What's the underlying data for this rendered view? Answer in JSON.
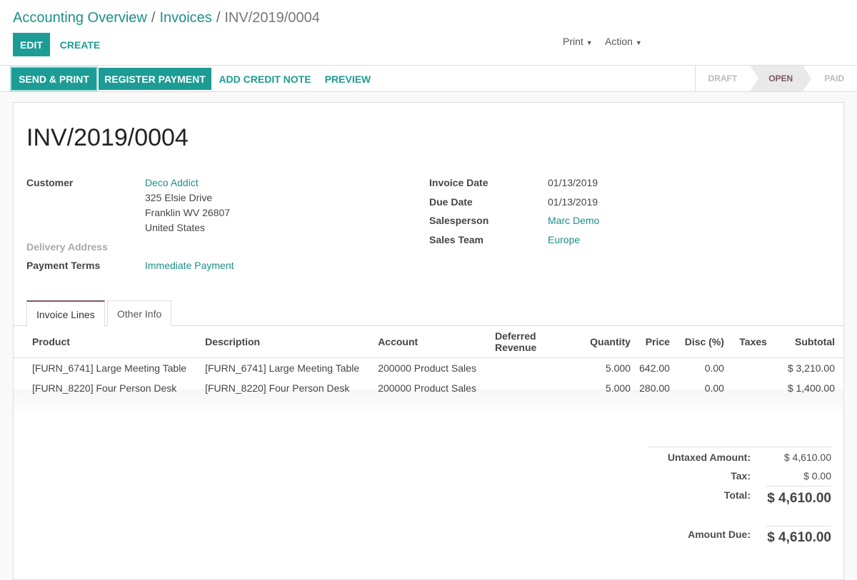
{
  "breadcrumb": {
    "items": [
      "Accounting Overview",
      "Invoices"
    ],
    "current": "INV/2019/0004"
  },
  "buttons": {
    "edit": "EDIT",
    "create": "CREATE",
    "print": "Print",
    "action": "Action",
    "send_print": "SEND & PRINT",
    "register_payment": "REGISTER PAYMENT",
    "add_credit_note": "ADD CREDIT NOTE",
    "preview": "PREVIEW"
  },
  "status": [
    "DRAFT",
    "OPEN",
    "PAID"
  ],
  "invoice": {
    "number": "INV/2019/0004",
    "customer_label": "Customer",
    "customer": "Deco Addict",
    "address": [
      "325 Elsie Drive",
      "Franklin WV 26807",
      "United States"
    ],
    "delivery_label": "Delivery Address",
    "payment_terms_label": "Payment Terms",
    "payment_terms": "Immediate Payment",
    "invoice_date_label": "Invoice Date",
    "invoice_date": "01/13/2019",
    "due_date_label": "Due Date",
    "due_date": "01/13/2019",
    "salesperson_label": "Salesperson",
    "salesperson": "Marc Demo",
    "team_label": "Sales Team",
    "team": "Europe"
  },
  "tabs": [
    "Invoice Lines",
    "Other Info"
  ],
  "columns": [
    "Product",
    "Description",
    "Account",
    "Deferred Revenue",
    "Quantity",
    "Price",
    "Disc (%)",
    "Taxes",
    "Subtotal"
  ],
  "lines": [
    {
      "product": "[FURN_6741] Large Meeting Table",
      "description": "[FURN_6741] Large Meeting Table",
      "account": "200000 Product Sales",
      "deferred": "",
      "quantity": "5.000",
      "price": "642.00",
      "disc": "0.00",
      "taxes": "",
      "subtotal": "$ 3,210.00"
    },
    {
      "product": "[FURN_8220] Four Person Desk",
      "description": "[FURN_8220] Four Person Desk",
      "account": "200000 Product Sales",
      "deferred": "",
      "quantity": "5.000",
      "price": "280.00",
      "disc": "0.00",
      "taxes": "",
      "subtotal": "$ 1,400.00"
    }
  ],
  "totals": {
    "untaxed_label": "Untaxed Amount:",
    "untaxed": "$ 4,610.00",
    "tax_label": "Tax:",
    "tax": "$ 0.00",
    "total_label": "Total:",
    "total": "$ 4,610.00",
    "due_label": "Amount Due:",
    "due": "$ 4,610.00"
  }
}
